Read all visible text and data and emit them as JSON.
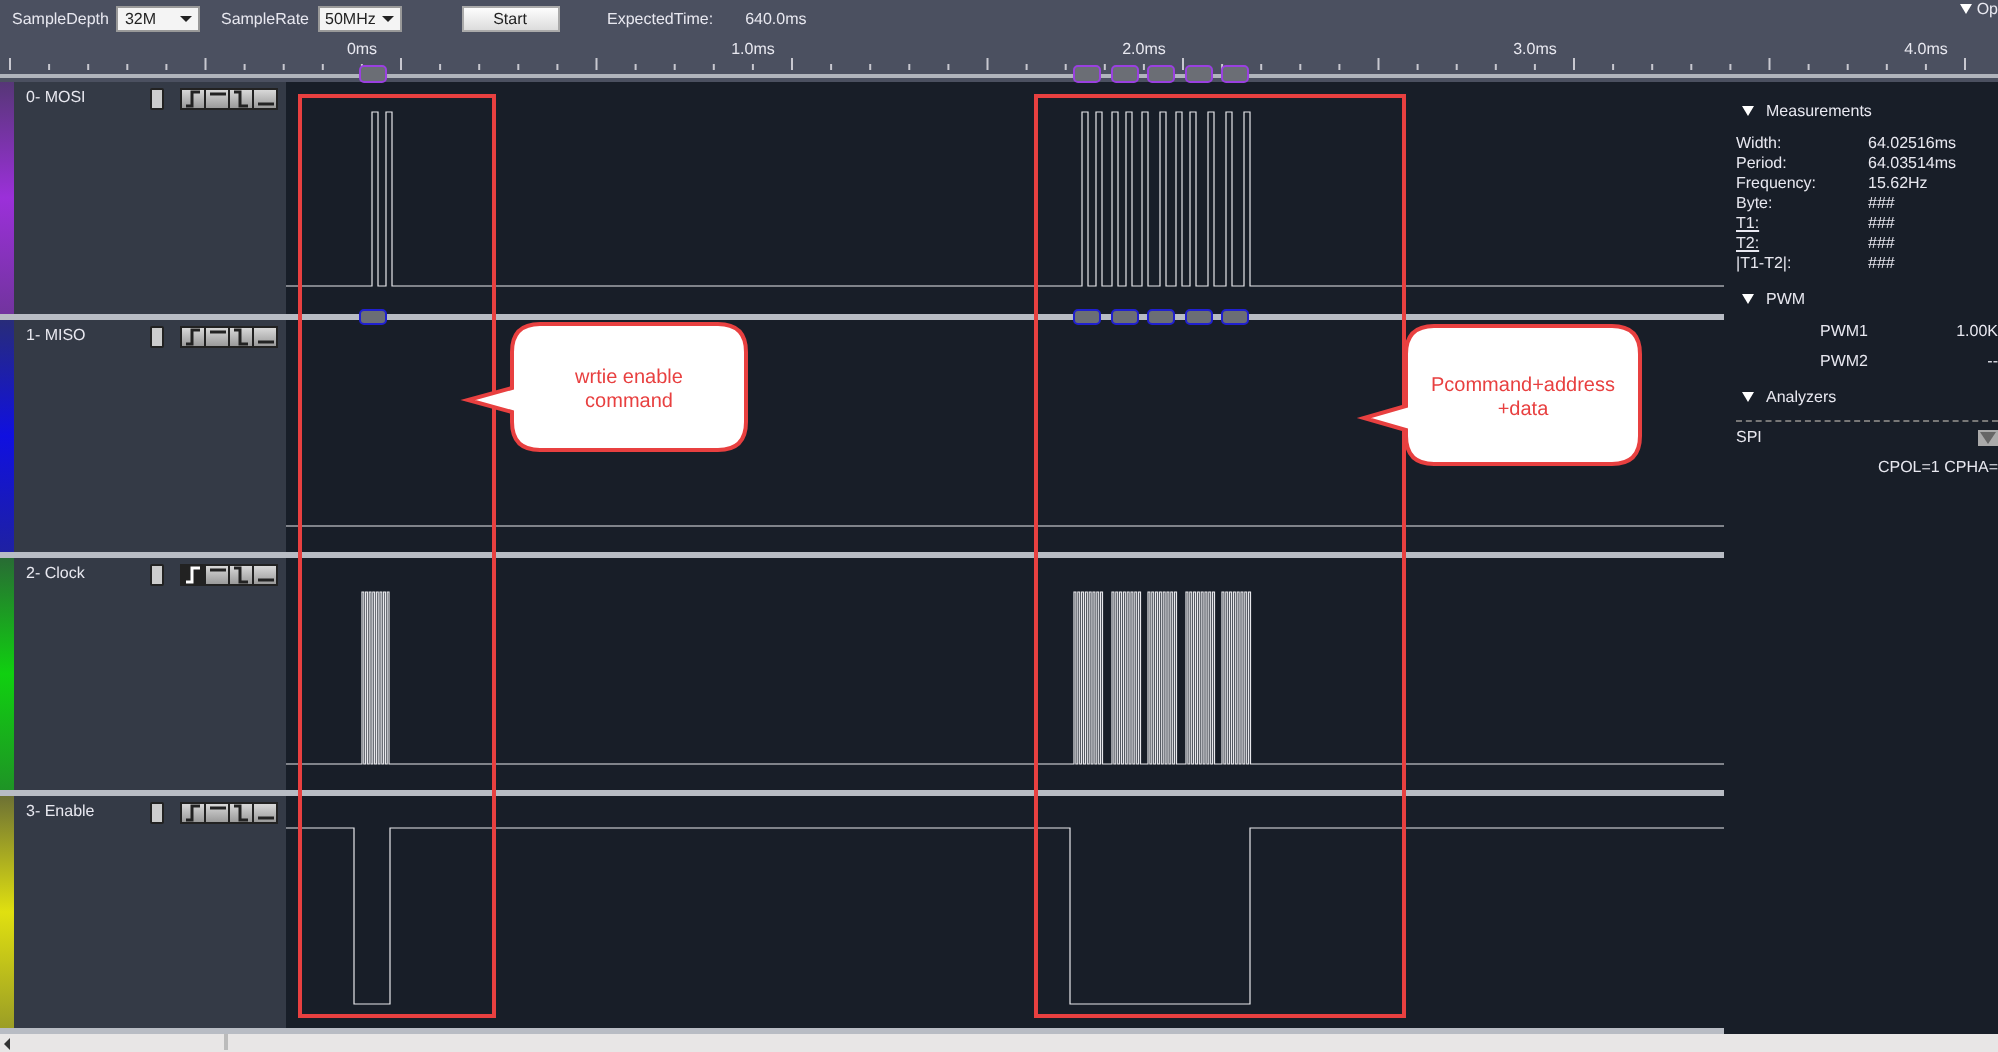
{
  "toolbar": {
    "sample_depth": {
      "label": "SampleDepth",
      "value": "32M"
    },
    "sample_rate": {
      "label": "SampleRate",
      "value": "50MHz"
    },
    "start_button": "Start",
    "expected_time": {
      "label": "ExpectedTime:",
      "value": "640.0ms"
    },
    "options_menu": "Op"
  },
  "ruler": {
    "labels": [
      "0ms",
      "1.0ms",
      "2.0ms",
      "3.0ms",
      "4.0ms"
    ]
  },
  "channels": [
    {
      "label": "0- MOSI",
      "color": "#9b30d9",
      "rising_trigger_selected": false
    },
    {
      "label": "1- MISO",
      "color": "#1010e0",
      "rising_trigger_selected": false
    },
    {
      "label": "2- Clock",
      "color": "#10d010",
      "rising_trigger_selected": true
    },
    {
      "label": "3- Enable",
      "color": "#e0e010",
      "rising_trigger_selected": false
    }
  ],
  "annotations": [
    {
      "lines": [
        "wrtie enable",
        "command"
      ]
    },
    {
      "lines": [
        "Pcommand+address",
        "+data"
      ]
    }
  ],
  "measurements": {
    "title": "Measurements",
    "rows": [
      {
        "label": "Width:",
        "value": "64.02516ms",
        "underlined": false
      },
      {
        "label": "Period:",
        "value": "64.03514ms",
        "underlined": false
      },
      {
        "label": "Frequency:",
        "value": "15.62Hz",
        "underlined": false
      },
      {
        "label": "Byte:",
        "value": "###",
        "underlined": false
      },
      {
        "label": "T1:",
        "value": "###",
        "underlined": true
      },
      {
        "label": "T2:",
        "value": "###",
        "underlined": true
      },
      {
        "label": "|T1-T2|:",
        "value": "###",
        "underlined": false
      }
    ]
  },
  "pwm": {
    "title": "PWM",
    "rows": [
      {
        "label": "PWM1",
        "value": "1.00K"
      },
      {
        "label": "PWM2",
        "value": "--"
      }
    ]
  },
  "analyzers": {
    "title": "Analyzers",
    "items": [
      {
        "name": "SPI",
        "settings": "CPOL=1 CPHA="
      }
    ]
  }
}
